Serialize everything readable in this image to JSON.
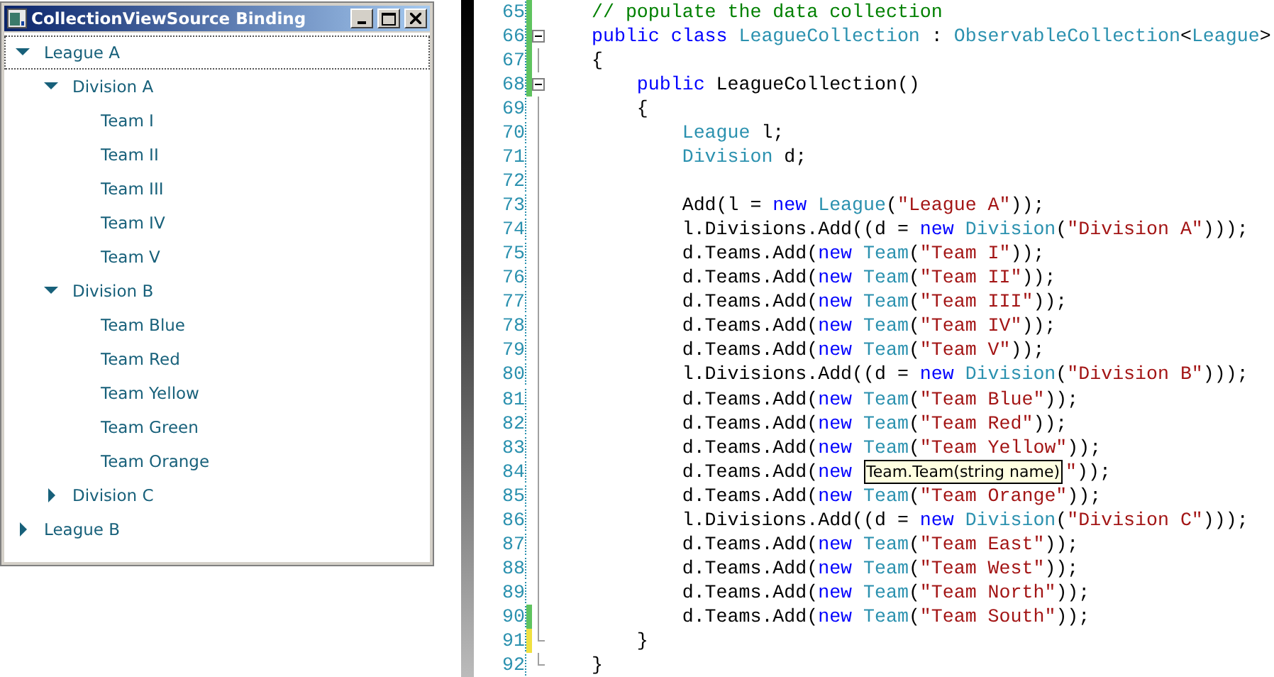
{
  "window": {
    "title": "CollectionViewSource Binding"
  },
  "tree": [
    {
      "label": "League A",
      "expanded": true,
      "selected": true,
      "children": [
        {
          "label": "Division A",
          "expanded": true,
          "selected": false,
          "children": [
            {
              "label": "Team I",
              "selected": false
            },
            {
              "label": "Team II",
              "selected": false
            },
            {
              "label": "Team III",
              "selected": false
            },
            {
              "label": "Team IV",
              "selected": false
            },
            {
              "label": "Team V",
              "selected": false
            }
          ]
        },
        {
          "label": "Division B",
          "expanded": true,
          "selected": false,
          "children": [
            {
              "label": "Team Blue",
              "selected": false
            },
            {
              "label": "Team Red",
              "selected": false
            },
            {
              "label": "Team Yellow",
              "selected": false
            },
            {
              "label": "Team Green",
              "selected": false
            },
            {
              "label": "Team Orange",
              "selected": false
            }
          ]
        },
        {
          "label": "Division C",
          "expanded": false,
          "selected": false
        }
      ]
    },
    {
      "label": "League B",
      "expanded": false,
      "selected": false
    }
  ],
  "editor": {
    "lines": [
      {
        "number": "65",
        "saved_change": true,
        "unsaved_change": false,
        "collapsible": false,
        "block_end": false,
        "tokens": [
          {
            "kind": "comment",
            "text": "// populate the data collection"
          }
        ]
      },
      {
        "number": "66",
        "saved_change": true,
        "unsaved_change": false,
        "collapsible": true,
        "block_end": false,
        "tokens": [
          {
            "kind": "keyword",
            "text": "public class "
          },
          {
            "kind": "type",
            "text": "LeagueCollection"
          },
          {
            "kind": "plain",
            "text": " : "
          },
          {
            "kind": "type",
            "text": "ObservableCollection"
          },
          {
            "kind": "plain",
            "text": "<"
          },
          {
            "kind": "type",
            "text": "League"
          },
          {
            "kind": "plain",
            "text": ">"
          }
        ]
      },
      {
        "number": "67",
        "saved_change": true,
        "unsaved_change": false,
        "collapsible": false,
        "block_end": false,
        "tokens": [
          {
            "kind": "plain",
            "text": "{"
          }
        ]
      },
      {
        "number": "68",
        "saved_change": true,
        "unsaved_change": false,
        "collapsible": true,
        "block_end": false,
        "tokens": [
          {
            "kind": "keyword",
            "text": "    public"
          },
          {
            "kind": "plain",
            "text": " LeagueCollection()"
          }
        ]
      },
      {
        "number": "69",
        "saved_change": false,
        "unsaved_change": false,
        "collapsible": false,
        "block_end": false,
        "tokens": [
          {
            "kind": "plain",
            "text": "    {"
          }
        ]
      },
      {
        "number": "70",
        "saved_change": false,
        "unsaved_change": false,
        "collapsible": false,
        "block_end": false,
        "tokens": [
          {
            "kind": "type",
            "text": "        League"
          },
          {
            "kind": "plain",
            "text": " l;"
          }
        ]
      },
      {
        "number": "71",
        "saved_change": false,
        "unsaved_change": false,
        "collapsible": false,
        "block_end": false,
        "tokens": [
          {
            "kind": "type",
            "text": "        Division"
          },
          {
            "kind": "plain",
            "text": " d;"
          }
        ]
      },
      {
        "number": "72",
        "saved_change": false,
        "unsaved_change": false,
        "collapsible": false,
        "block_end": false
      },
      {
        "number": "73",
        "saved_change": false,
        "unsaved_change": false,
        "collapsible": false,
        "block_end": false,
        "tokens": [
          {
            "kind": "plain",
            "text": "        Add(l = "
          },
          {
            "kind": "keyword",
            "text": "new "
          },
          {
            "kind": "type",
            "text": "League"
          },
          {
            "kind": "plain",
            "text": "("
          },
          {
            "kind": "string",
            "text": "\"League A\""
          },
          {
            "kind": "plain",
            "text": "));"
          }
        ]
      },
      {
        "number": "74",
        "saved_change": false,
        "unsaved_change": false,
        "collapsible": false,
        "block_end": false,
        "tokens": [
          {
            "kind": "plain",
            "text": "        l.Divisions.Add((d = "
          },
          {
            "kind": "keyword",
            "text": "new "
          },
          {
            "kind": "type",
            "text": "Division"
          },
          {
            "kind": "plain",
            "text": "("
          },
          {
            "kind": "string",
            "text": "\"Division A\""
          },
          {
            "kind": "plain",
            "text": ")));"
          }
        ]
      },
      {
        "number": "75",
        "saved_change": false,
        "unsaved_change": false,
        "collapsible": false,
        "block_end": false,
        "tokens": [
          {
            "kind": "plain",
            "text": "        d.Teams.Add("
          },
          {
            "kind": "keyword",
            "text": "new "
          },
          {
            "kind": "type",
            "text": "Team"
          },
          {
            "kind": "plain",
            "text": "("
          },
          {
            "kind": "string",
            "text": "\"Team I\""
          },
          {
            "kind": "plain",
            "text": "));"
          }
        ]
      },
      {
        "number": "76",
        "saved_change": false,
        "unsaved_change": false,
        "collapsible": false,
        "block_end": false,
        "tokens": [
          {
            "kind": "plain",
            "text": "        d.Teams.Add("
          },
          {
            "kind": "keyword",
            "text": "new "
          },
          {
            "kind": "type",
            "text": "Team"
          },
          {
            "kind": "plain",
            "text": "("
          },
          {
            "kind": "string",
            "text": "\"Team II\""
          },
          {
            "kind": "plain",
            "text": "));"
          }
        ]
      },
      {
        "number": "77",
        "saved_change": false,
        "unsaved_change": false,
        "collapsible": false,
        "block_end": false,
        "tokens": [
          {
            "kind": "plain",
            "text": "        d.Teams.Add("
          },
          {
            "kind": "keyword",
            "text": "new "
          },
          {
            "kind": "type",
            "text": "Team"
          },
          {
            "kind": "plain",
            "text": "("
          },
          {
            "kind": "string",
            "text": "\"Team III\""
          },
          {
            "kind": "plain",
            "text": "));"
          }
        ]
      },
      {
        "number": "78",
        "saved_change": false,
        "unsaved_change": false,
        "collapsible": false,
        "block_end": false,
        "tokens": [
          {
            "kind": "plain",
            "text": "        d.Teams.Add("
          },
          {
            "kind": "keyword",
            "text": "new "
          },
          {
            "kind": "type",
            "text": "Team"
          },
          {
            "kind": "plain",
            "text": "("
          },
          {
            "kind": "string",
            "text": "\"Team IV\""
          },
          {
            "kind": "plain",
            "text": "));"
          }
        ]
      },
      {
        "number": "79",
        "saved_change": false,
        "unsaved_change": false,
        "collapsible": false,
        "block_end": false,
        "tokens": [
          {
            "kind": "plain",
            "text": "        d.Teams.Add("
          },
          {
            "kind": "keyword",
            "text": "new "
          },
          {
            "kind": "type",
            "text": "Team"
          },
          {
            "kind": "plain",
            "text": "("
          },
          {
            "kind": "string",
            "text": "\"Team V\""
          },
          {
            "kind": "plain",
            "text": "));"
          }
        ]
      },
      {
        "number": "80",
        "saved_change": false,
        "unsaved_change": false,
        "collapsible": false,
        "block_end": false,
        "tokens": [
          {
            "kind": "plain",
            "text": "        l.Divisions.Add((d = "
          },
          {
            "kind": "keyword",
            "text": "new "
          },
          {
            "kind": "type",
            "text": "Division"
          },
          {
            "kind": "plain",
            "text": "("
          },
          {
            "kind": "string",
            "text": "\"Division B\""
          },
          {
            "kind": "plain",
            "text": ")));"
          }
        ]
      },
      {
        "number": "81",
        "saved_change": false,
        "unsaved_change": false,
        "collapsible": false,
        "block_end": false,
        "tokens": [
          {
            "kind": "plain",
            "text": "        d.Teams.Add("
          },
          {
            "kind": "keyword",
            "text": "new "
          },
          {
            "kind": "type",
            "text": "Team"
          },
          {
            "kind": "plain",
            "text": "("
          },
          {
            "kind": "string",
            "text": "\"Team Blue\""
          },
          {
            "kind": "plain",
            "text": "));"
          }
        ]
      },
      {
        "number": "82",
        "saved_change": false,
        "unsaved_change": false,
        "collapsible": false,
        "block_end": false,
        "tokens": [
          {
            "kind": "plain",
            "text": "        d.Teams.Add("
          },
          {
            "kind": "keyword",
            "text": "new "
          },
          {
            "kind": "type",
            "text": "Team"
          },
          {
            "kind": "plain",
            "text": "("
          },
          {
            "kind": "string",
            "text": "\"Team Red\""
          },
          {
            "kind": "plain",
            "text": "));"
          }
        ]
      },
      {
        "number": "83",
        "saved_change": false,
        "unsaved_change": false,
        "collapsible": false,
        "block_end": false,
        "tokens": [
          {
            "kind": "plain",
            "text": "        d.Teams.Add("
          },
          {
            "kind": "keyword",
            "text": "new "
          },
          {
            "kind": "type",
            "text": "Team"
          },
          {
            "kind": "plain",
            "text": "("
          },
          {
            "kind": "string",
            "text": "\"Team Yellow\""
          },
          {
            "kind": "plain",
            "text": "));"
          }
        ]
      },
      {
        "number": "84",
        "saved_change": false,
        "unsaved_change": false,
        "collapsible": false,
        "block_end": false,
        "tokens": [
          {
            "kind": "plain",
            "text": "        d.Teams.Add("
          },
          {
            "kind": "keyword",
            "text": "new "
          },
          {
            "kind": "tooltip",
            "text": "Team.Team(string name)"
          },
          {
            "kind": "string",
            "text": "\""
          },
          {
            "kind": "plain",
            "text": "));"
          }
        ]
      },
      {
        "number": "85",
        "saved_change": false,
        "unsaved_change": false,
        "collapsible": false,
        "block_end": false,
        "tokens": [
          {
            "kind": "plain",
            "text": "        d.Teams.Add("
          },
          {
            "kind": "keyword",
            "text": "new "
          },
          {
            "kind": "type",
            "text": "Team"
          },
          {
            "kind": "plain",
            "text": "("
          },
          {
            "kind": "string",
            "text": "\"Team Orange\""
          },
          {
            "kind": "plain",
            "text": "));"
          }
        ]
      },
      {
        "number": "86",
        "saved_change": false,
        "unsaved_change": false,
        "collapsible": false,
        "block_end": false,
        "tokens": [
          {
            "kind": "plain",
            "text": "        l.Divisions.Add((d = "
          },
          {
            "kind": "keyword",
            "text": "new "
          },
          {
            "kind": "type",
            "text": "Division"
          },
          {
            "kind": "plain",
            "text": "("
          },
          {
            "kind": "string",
            "text": "\"Division C\""
          },
          {
            "kind": "plain",
            "text": ")));"
          }
        ]
      },
      {
        "number": "87",
        "saved_change": false,
        "unsaved_change": false,
        "collapsible": false,
        "block_end": false,
        "tokens": [
          {
            "kind": "plain",
            "text": "        d.Teams.Add("
          },
          {
            "kind": "keyword",
            "text": "new "
          },
          {
            "kind": "type",
            "text": "Team"
          },
          {
            "kind": "plain",
            "text": "("
          },
          {
            "kind": "string",
            "text": "\"Team East\""
          },
          {
            "kind": "plain",
            "text": "));"
          }
        ]
      },
      {
        "number": "88",
        "saved_change": false,
        "unsaved_change": false,
        "collapsible": false,
        "block_end": false,
        "tokens": [
          {
            "kind": "plain",
            "text": "        d.Teams.Add("
          },
          {
            "kind": "keyword",
            "text": "new "
          },
          {
            "kind": "type",
            "text": "Team"
          },
          {
            "kind": "plain",
            "text": "("
          },
          {
            "kind": "string",
            "text": "\"Team West\""
          },
          {
            "kind": "plain",
            "text": "));"
          }
        ]
      },
      {
        "number": "89",
        "saved_change": false,
        "unsaved_change": false,
        "collapsible": false,
        "block_end": false,
        "tokens": [
          {
            "kind": "plain",
            "text": "        d.Teams.Add("
          },
          {
            "kind": "keyword",
            "text": "new "
          },
          {
            "kind": "type",
            "text": "Team"
          },
          {
            "kind": "plain",
            "text": "("
          },
          {
            "kind": "string",
            "text": "\"Team North\""
          },
          {
            "kind": "plain",
            "text": "));"
          }
        ]
      },
      {
        "number": "90",
        "saved_change": true,
        "unsaved_change": false,
        "collapsible": false,
        "block_end": false,
        "tokens": [
          {
            "kind": "plain",
            "text": "        d.Teams.Add("
          },
          {
            "kind": "keyword",
            "text": "new "
          },
          {
            "kind": "type",
            "text": "Team"
          },
          {
            "kind": "plain",
            "text": "("
          },
          {
            "kind": "string",
            "text": "\"Team South\""
          },
          {
            "kind": "plain",
            "text": "));"
          }
        ]
      },
      {
        "number": "91",
        "saved_change": false,
        "unsaved_change": true,
        "collapsible": false,
        "block_end": true,
        "tokens": [
          {
            "kind": "plain",
            "text": "    }"
          }
        ]
      },
      {
        "number": "92",
        "saved_change": false,
        "unsaved_change": false,
        "collapsible": false,
        "block_end": true,
        "tokens": [
          {
            "kind": "plain",
            "text": "}"
          }
        ]
      }
    ]
  }
}
